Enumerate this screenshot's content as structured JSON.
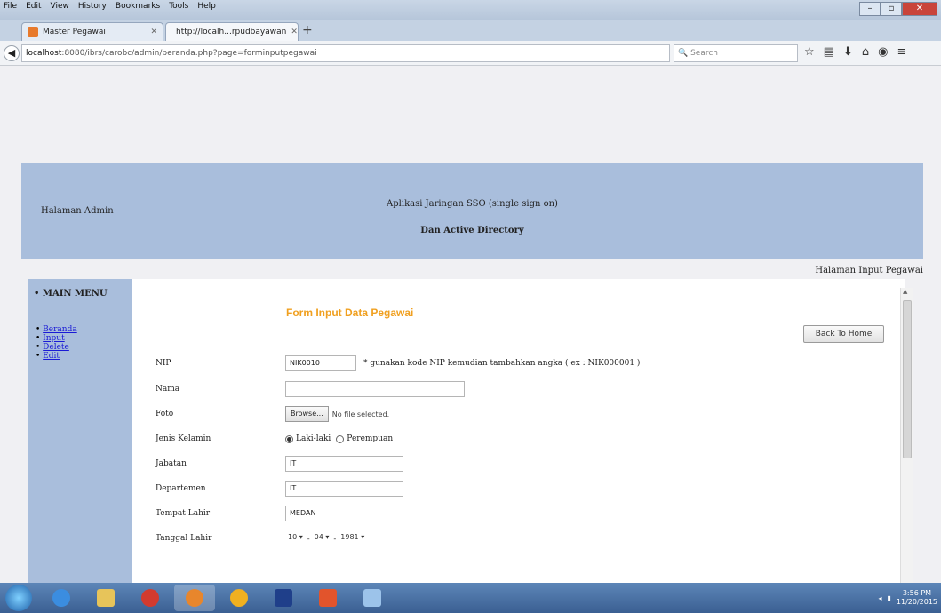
{
  "browser": {
    "menu": [
      "File",
      "Edit",
      "View",
      "History",
      "Bookmarks",
      "Tools",
      "Help"
    ],
    "tabs": [
      {
        "label": "Master Pegawai"
      },
      {
        "label": "http://localh...rpudbayawan"
      }
    ],
    "url_host": "localhost",
    "url_rest": ":8080/ibrs/carobc/admin/beranda.php?page=forminputpegawai",
    "search_placeholder": "Search"
  },
  "header": {
    "left": "Halaman Admin",
    "title": "Aplikasi Jaringan SSO (single sign on)",
    "subtitle": "Dan Active Directory"
  },
  "page_label": "Halaman Input Pegawai",
  "sidebar": {
    "title": "MAIN MENU",
    "items": [
      "Beranda",
      "Input",
      "Delete",
      "Edit"
    ]
  },
  "form": {
    "title": "Form Input Data Pegawai",
    "back_home": "Back To Home",
    "nip_label": "NIP",
    "nip_value": "NIK0010",
    "nip_hint": "* gunakan kode NIP kemudian tambahkan angka ( ex : NIK000001 )",
    "nama_label": "Nama",
    "nama_value": "",
    "foto_label": "Foto",
    "browse_label": "Browse...",
    "nofile_text": "No file selected.",
    "jk_label": "Jenis Kelamin",
    "jk_options": [
      "Laki-laki",
      "Perempuan"
    ],
    "jk_selected": "Laki-laki",
    "jabatan_label": "Jabatan",
    "jabatan_value": "IT",
    "departemen_label": "Departemen",
    "departemen_value": "IT",
    "tempat_label": "Tempat Lahir",
    "tempat_value": "MEDAN",
    "tanggal_label": "Tanggal Lahir",
    "tanggal_day": "10",
    "tanggal_month": "04",
    "tanggal_year": "1981"
  },
  "taskbar": {
    "time": "3:56 PM",
    "date": "11/20/2015"
  }
}
